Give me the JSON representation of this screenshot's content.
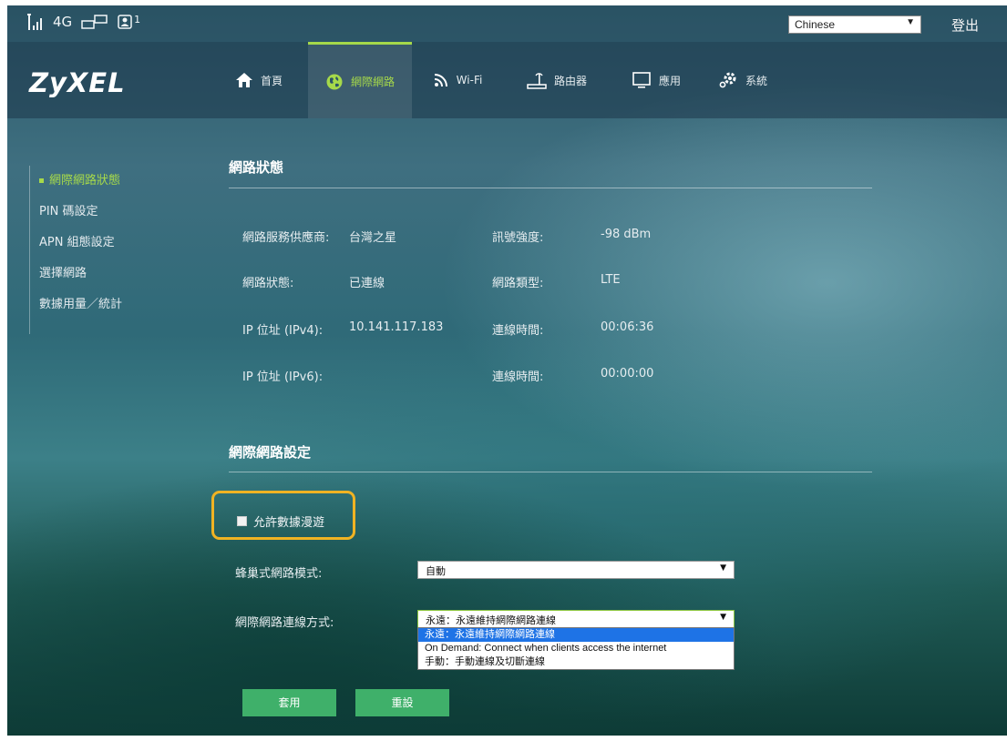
{
  "statusbar": {
    "network_type": "4G",
    "user_count": "1",
    "language": "Chinese",
    "logout_label": "登出"
  },
  "header": {
    "logo": "ZyXEL",
    "nav": [
      {
        "label": "首頁",
        "icon": "home-icon"
      },
      {
        "label": "網際網路",
        "icon": "globe-icon",
        "active": true
      },
      {
        "label": "Wi-Fi",
        "icon": "wifi-icon"
      },
      {
        "label": "路由器",
        "icon": "router-icon"
      },
      {
        "label": "應用",
        "icon": "monitor-icon"
      },
      {
        "label": "系統",
        "icon": "gear-icon"
      }
    ]
  },
  "sidebar": {
    "items": [
      {
        "label": "網際網路狀態",
        "active": true
      },
      {
        "label": "PIN 碼設定"
      },
      {
        "label": "APN 組態設定"
      },
      {
        "label": "選擇網路"
      },
      {
        "label": "數據用量／統計"
      }
    ]
  },
  "status_section": {
    "title": "網路狀態",
    "rows": [
      {
        "label": "網路服務供應商:",
        "value": "台灣之星",
        "label2": "訊號強度:",
        "value2": "-98 dBm"
      },
      {
        "label": "網路狀態:",
        "value": "已連線",
        "label2": "網路類型:",
        "value2": "LTE"
      },
      {
        "label": "IP 位址 (IPv4):",
        "value": "10.141.117.183",
        "label2": "連線時間:",
        "value2": "00:06:36"
      },
      {
        "label": "IP 位址 (IPv6):",
        "value": "",
        "label2": "連線時間:",
        "value2": "00:00:00"
      }
    ]
  },
  "settings_section": {
    "title": "網際網路設定",
    "roaming_label": "允許數據漫遊",
    "cellular_mode_label": "蜂巢式網路模式:",
    "cellular_mode_value": "自動",
    "connection_label": "網際網路連線方式:",
    "connection_value": "永遠：永遠維持網際網路連線",
    "connection_options": [
      "永遠：永遠維持網際網路連線",
      "On Demand: Connect when clients access the internet",
      "手動：手動連線及切斷連線"
    ]
  },
  "buttons": {
    "apply": "套用",
    "reset": "重設"
  },
  "colors": {
    "accent": "#a6d94a",
    "button": "#3fb06a",
    "highlight": "#f0b323",
    "dropdown_selected": "#1e73e6"
  }
}
